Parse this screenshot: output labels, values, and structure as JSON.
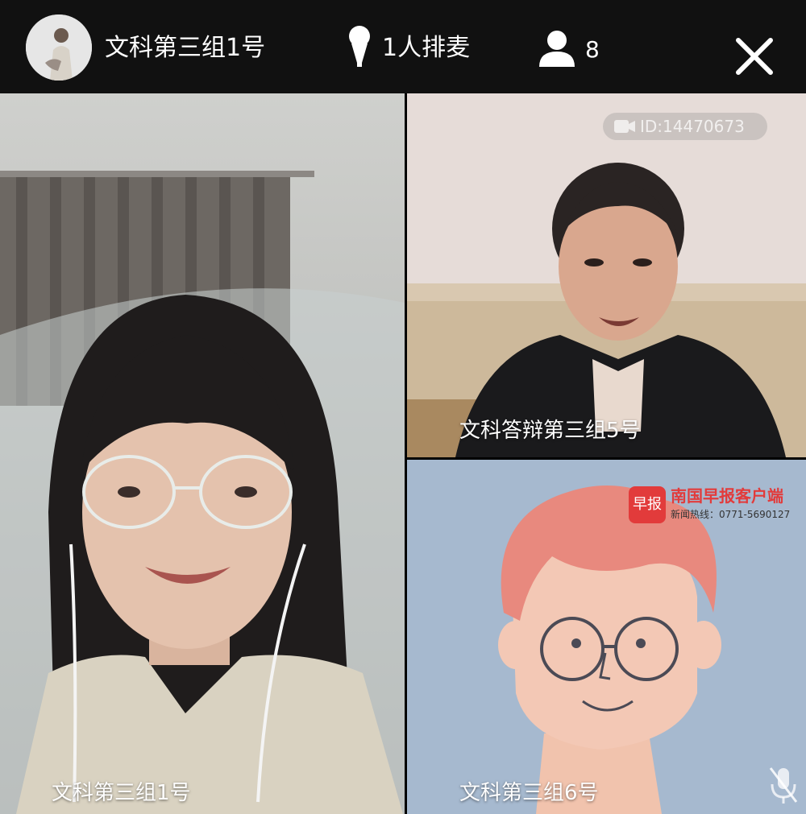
{
  "header": {
    "room_title": "文科第三组1号",
    "queue_text": "1人排麦",
    "viewer_count": "8"
  },
  "icons": {
    "mic": "microphone-icon",
    "viewers": "user-icon",
    "close": "close-icon",
    "camera": "camera-icon",
    "mute": "mic-muted-icon"
  },
  "tiles": {
    "main": {
      "label": "文科第三组1号"
    },
    "top_right": {
      "label": "文科答辩第三组5号",
      "id_badge": "ID:14470673"
    },
    "bottom_right": {
      "label": "文科第三组6号"
    }
  },
  "watermark": {
    "logo_text": "早报",
    "name": "南国早报客户端",
    "hotline": "新闻热线：0771-5690127"
  },
  "colors": {
    "topbar": "#111111",
    "watermark_red": "#e23b3b",
    "cartoon_bg": "#a6b9cf",
    "cartoon_hair": "#e8897e"
  }
}
